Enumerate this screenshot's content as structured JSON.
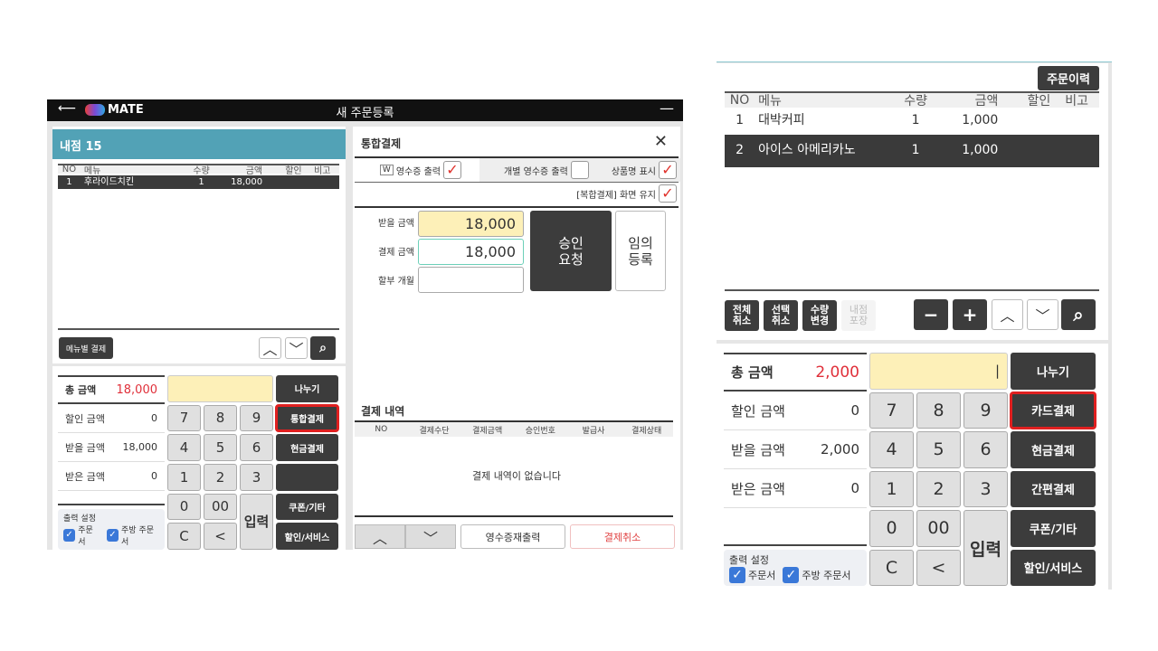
{
  "left_app": {
    "title": "새 주문등록",
    "logo": "MATE",
    "back_icon": "back-arrow-icon",
    "minimize": "—",
    "table_name": "내점 15",
    "order_headers": [
      "NO",
      "메뉴",
      "수량",
      "금액",
      "할인",
      "비고"
    ],
    "order_rows": [
      {
        "no": "1",
        "menu": "후라이드치킨",
        "qty": "1",
        "amount": "18,000",
        "discount": "",
        "note": "",
        "selected": true
      }
    ],
    "menu_pay_button": "메뉴별 결제",
    "keypad": {
      "summary": {
        "total_label": "총 금액",
        "total": "18,000",
        "discount_label": "할인 금액",
        "discount": "0",
        "receivable_label": "받을 금액",
        "receivable": "18,000",
        "received_label": "받은 금액",
        "received": "0"
      },
      "display": "",
      "output_settings": {
        "label": "출력 설정",
        "order_sheet": "주문서",
        "kitchen_order": "주방 주문서"
      },
      "functions": [
        "나누기",
        "통합결제",
        "현금결제",
        "",
        "쿠폰/기타",
        "할인/서비스"
      ],
      "highlighted_function": 1
    }
  },
  "dialog": {
    "title": "통합결제",
    "receipt_print": "영수증 출력",
    "receipt_print_checked": true,
    "individual_receipt": "개별 영수증 출력",
    "individual_receipt_checked": false,
    "show_product_name": "상품명 표시",
    "show_product_name_checked": true,
    "keep_screen": "[복합결제] 화면 유지",
    "keep_screen_checked": true,
    "receivable_label": "받을 금액",
    "receivable": "18,000",
    "pay_label": "결제 금액",
    "pay": "18,000",
    "installment_label": "할부 개월",
    "installment": "",
    "approve_button": "승인\n요청",
    "manual_button": "임의\n등록",
    "history_title": "결제 내역",
    "history_headers": [
      "NO",
      "결제수단",
      "결제금액",
      "승인번호",
      "발급사",
      "결제상태"
    ],
    "history_empty": "결제 내역이 없습니다",
    "reprint_button": "영수증재출력",
    "cancel_button": "결제취소"
  },
  "right_app": {
    "order_history_button": "주문이력",
    "order_headers": [
      "NO",
      "메뉴",
      "수량",
      "금액",
      "할인",
      "비고"
    ],
    "order_rows": [
      {
        "no": "1",
        "menu": "대박커피",
        "qty": "1",
        "amount": "1,000",
        "discount": "",
        "note": "",
        "selected": false
      },
      {
        "no": "2",
        "menu": "아이스 아메리카노",
        "qty": "1",
        "amount": "1,000",
        "discount": "",
        "note": "",
        "selected": true
      }
    ],
    "actions": [
      "전체\n취소",
      "선택\n취소",
      "수량\n변경",
      "내점\n포장"
    ],
    "keypad": {
      "summary": {
        "total_label": "총 금액",
        "total": "2,000",
        "discount_label": "할인 금액",
        "discount": "0",
        "receivable_label": "받을 금액",
        "receivable": "2,000",
        "received_label": "받은 금액",
        "received": "0"
      },
      "display": "|",
      "output_settings": {
        "label": "출력 설정",
        "order_sheet": "주문서",
        "kitchen_order": "주방 주문서"
      },
      "functions": [
        "나누기",
        "카드결제",
        "현금결제",
        "간편결제",
        "쿠폰/기타",
        "할인/서비스"
      ],
      "highlighted_function": 1
    }
  },
  "keys": [
    "7",
    "8",
    "9",
    "4",
    "5",
    "6",
    "1",
    "2",
    "3",
    "0",
    "00",
    "입력",
    "C",
    "<"
  ],
  "colors": {
    "header_teal": "#52a2b6",
    "highlight_red": "#e02020",
    "total_red": "#e0303a",
    "display_yellow": "#fdf0b8",
    "dark_button": "#3c3c3c"
  }
}
